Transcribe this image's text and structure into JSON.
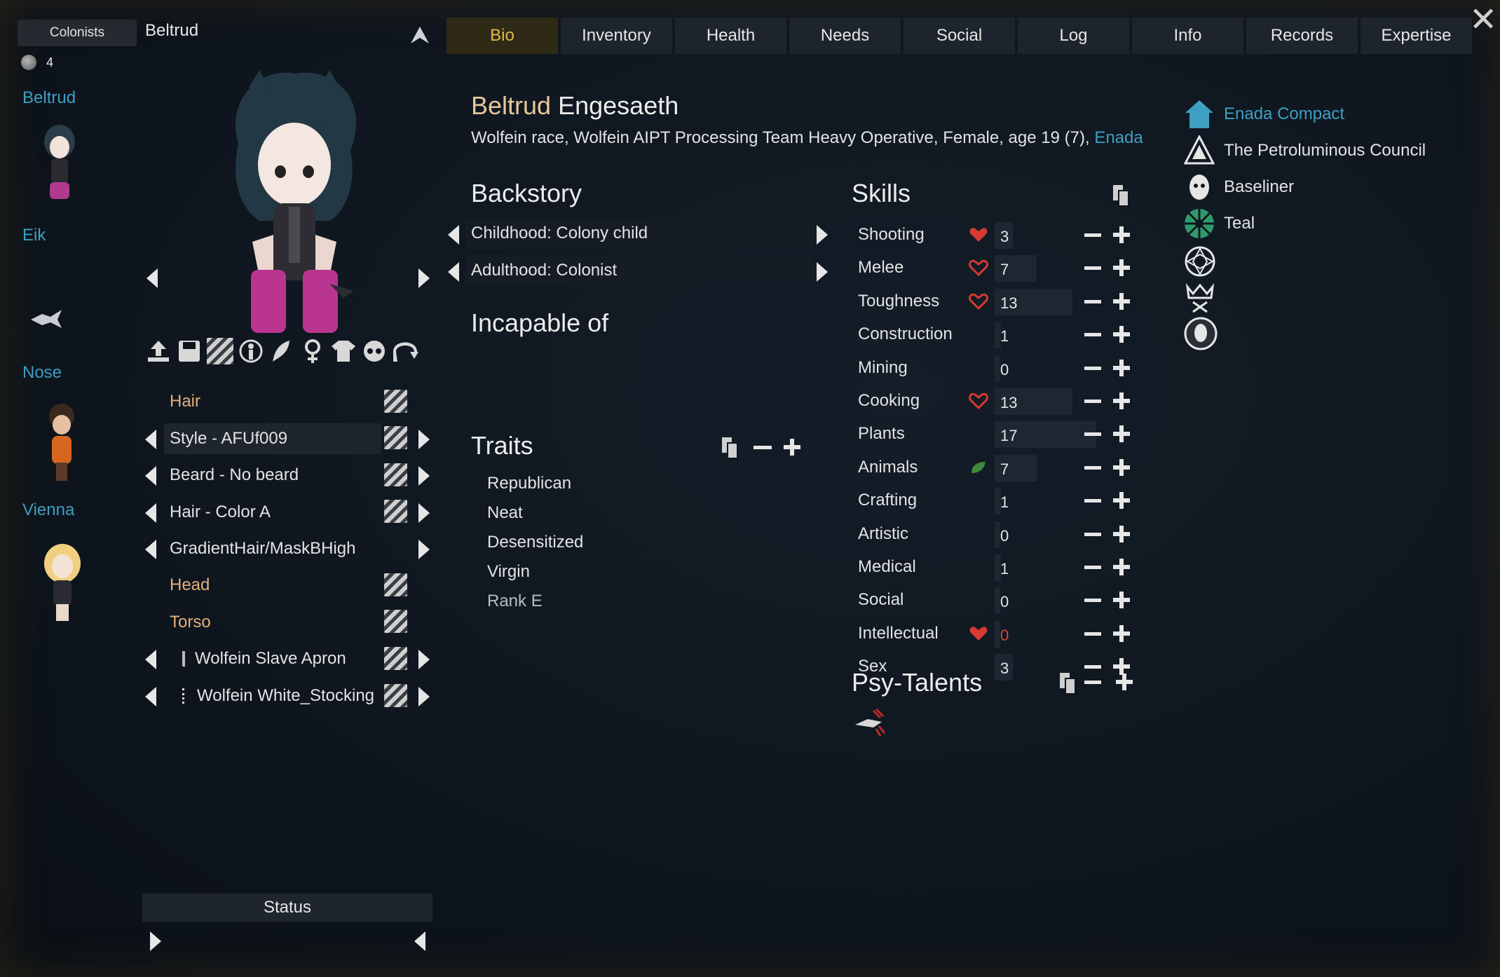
{
  "window": {
    "close_icon": "close-icon"
  },
  "left": {
    "colonists_label": "Colonists",
    "count": "4",
    "colonists": [
      {
        "name": "Beltrud"
      },
      {
        "name": "Eik"
      },
      {
        "name": "Nose"
      },
      {
        "name": "Vienna"
      }
    ]
  },
  "pawn": {
    "name": "Beltrud"
  },
  "appearance": {
    "rows": [
      {
        "label": "Hair"
      },
      {
        "label": "Style - AFUf009"
      },
      {
        "label": "Beard - No beard"
      },
      {
        "label": "Hair - Color A"
      },
      {
        "label": "GradientHair/MaskBHigh"
      },
      {
        "label": "Head"
      },
      {
        "label": "Torso"
      },
      {
        "label": "Wolfein Slave Apron"
      },
      {
        "label": "Wolfein White_Stocking"
      }
    ]
  },
  "status_label": "Status",
  "tabs": [
    "Bio",
    "Inventory",
    "Health",
    "Needs",
    "Social",
    "Log",
    "Info",
    "Records",
    "Expertise"
  ],
  "bio": {
    "first_name": "Beltrud",
    "last_name": "Engesaeth",
    "description": "Wolfein race, Wolfein AIPT Processing Team Heavy Operative, Female, age 19 (7),",
    "faction_link": "Enada",
    "backstory_title": "Backstory",
    "childhood": "Childhood: Colony child",
    "adulthood": "Adulthood: Colonist",
    "incapable_title": "Incapable of",
    "traits_title": "Traits",
    "traits": [
      "Republican",
      "Neat",
      "Desensitized",
      "Virgin",
      "Rank E"
    ]
  },
  "skills": {
    "title": "Skills",
    "items": [
      {
        "name": "Shooting",
        "value": "3",
        "level": 3,
        "passion": "heart-filled"
      },
      {
        "name": "Melee",
        "value": "7",
        "level": 7,
        "passion": "heart-outline"
      },
      {
        "name": "Toughness",
        "value": "13",
        "level": 13,
        "passion": "heart-outline"
      },
      {
        "name": "Construction",
        "value": "1",
        "level": 1,
        "passion": "none"
      },
      {
        "name": "Mining",
        "value": "0",
        "level": 0,
        "passion": "none"
      },
      {
        "name": "Cooking",
        "value": "13",
        "level": 13,
        "passion": "heart-outline"
      },
      {
        "name": "Plants",
        "value": "17",
        "level": 17,
        "passion": "none"
      },
      {
        "name": "Animals",
        "value": "7",
        "level": 7,
        "passion": "leaf"
      },
      {
        "name": "Crafting",
        "value": "1",
        "level": 1,
        "passion": "none"
      },
      {
        "name": "Artistic",
        "value": "0",
        "level": 0,
        "passion": "none"
      },
      {
        "name": "Medical",
        "value": "1",
        "level": 1,
        "passion": "none"
      },
      {
        "name": "Social",
        "value": "0",
        "level": 0,
        "passion": "none"
      },
      {
        "name": "Intellectual",
        "value": "0",
        "level": 0,
        "passion": "heart-filled",
        "disabled": true
      },
      {
        "name": "Sex",
        "value": "3",
        "level": 3,
        "passion": "none"
      }
    ]
  },
  "psy_title": "Psy-Talents",
  "factions": [
    {
      "name": "Enada Compact",
      "icon": "house-icon",
      "link": true
    },
    {
      "name": "The Petroluminous Council",
      "icon": "triangle-icon"
    },
    {
      "name": "Baseliner",
      "icon": "face-icon"
    },
    {
      "name": "Teal",
      "icon": "wheel-icon"
    }
  ],
  "colors": {
    "accent": "#3f9fc2",
    "tab_active": "#e3b94a",
    "passion": "#d63a33"
  }
}
